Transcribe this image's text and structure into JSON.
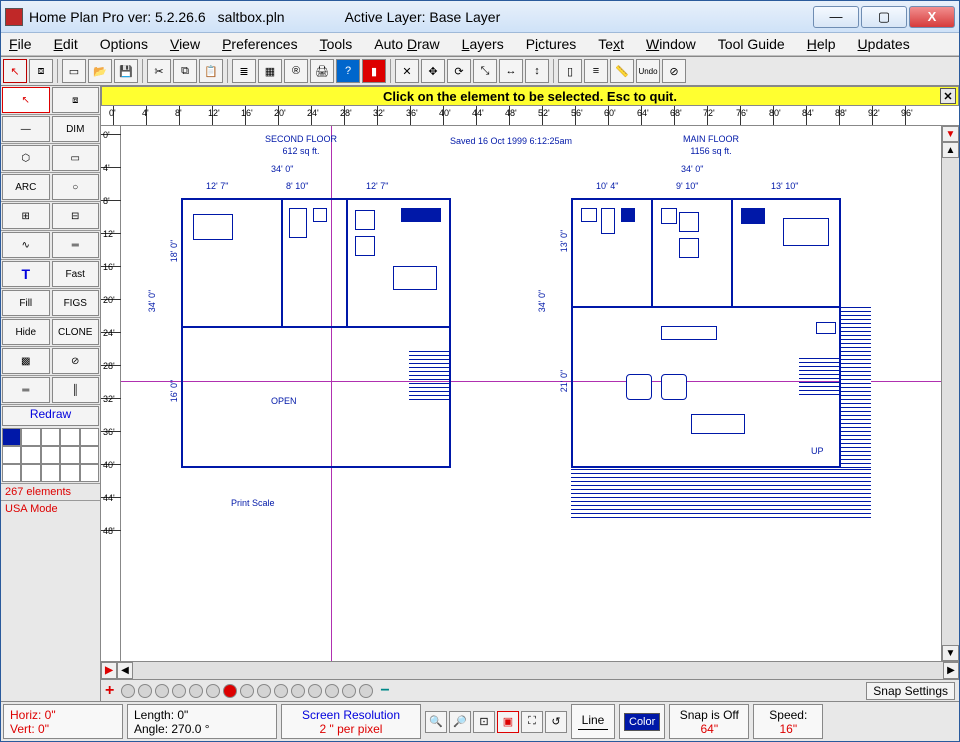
{
  "title": {
    "app": "Home Plan Pro ver: 5.2.26.6",
    "file": "saltbox.pln",
    "layer": "Active Layer: Base Layer"
  },
  "menu": [
    "File",
    "Edit",
    "Options",
    "View",
    "Preferences",
    "Tools",
    "Auto Draw",
    "Layers",
    "Pictures",
    "Text",
    "Window",
    "Tool Guide",
    "Help",
    "Updates"
  ],
  "hint": "Click on the element to be selected.  Esc to quit.",
  "hruler": [
    "0'",
    "4'",
    "8'",
    "12'",
    "16'",
    "20'",
    "24'",
    "28'",
    "32'",
    "36'",
    "40'",
    "44'",
    "48'",
    "52'",
    "56'",
    "60'",
    "64'",
    "68'",
    "72'",
    "76'",
    "80'",
    "84'",
    "88'",
    "92'",
    "96'"
  ],
  "vruler": [
    "0'",
    "4'",
    "8'",
    "12'",
    "16'",
    "20'",
    "24'",
    "28'",
    "32'",
    "36'",
    "40'",
    "44'",
    "48'"
  ],
  "left": {
    "dim": "DIM",
    "redraw": "Redraw",
    "elements": "267 elements",
    "mode": "USA Mode",
    "labels": {
      "arc": "ARC",
      "fast": "Fast",
      "fill": "Fill",
      "figs": "FIGS",
      "hide": "Hide",
      "clone": "CLONE",
      "text": "T"
    }
  },
  "plan": {
    "saved": "Saved 16 Oct 1999  6:12:25am",
    "printscale": "Print Scale",
    "second": {
      "title": "SECOND FLOOR",
      "area": "612 sq ft.",
      "width": "34' 0\"",
      "h": "34' 0\"",
      "cols": [
        "12' 7\"",
        "8' 10\"",
        "12' 7\""
      ],
      "left": [
        "18' 0\"",
        "16' 0\""
      ],
      "open": "OPEN"
    },
    "main": {
      "title": "MAIN FLOOR",
      "area": "1156 sq ft.",
      "width": "34' 0\"",
      "h": "34' 0\"",
      "cols": [
        "10' 4\"",
        "9' 10\"",
        "13' 10\""
      ],
      "left": [
        "13' 0\"",
        "21' 0\""
      ],
      "up": "UP"
    }
  },
  "snap_settings": "Snap Settings",
  "status": {
    "horiz": "Horiz:  0\"",
    "vert": "Vert:  0\"",
    "length": "Length:   0\"",
    "angle": "Angle: 270.0 °",
    "res1": "Screen Resolution",
    "res2": "2 \" per pixel",
    "line": "Line",
    "color": "Color",
    "snap1": "Snap is Off",
    "snap2": "64\"",
    "speed1": "Speed:",
    "speed2": "16\""
  }
}
